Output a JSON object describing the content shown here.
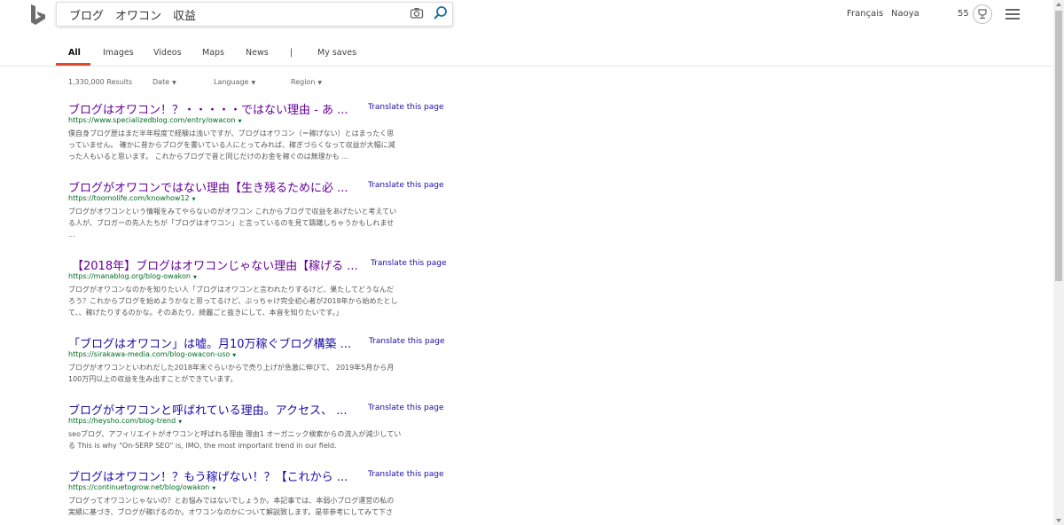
{
  "search": {
    "query": "ブログ　オワコン　収益"
  },
  "header": {
    "language": "Français",
    "user": "Naoya",
    "points": "55"
  },
  "tabs": [
    "All",
    "Images",
    "Videos",
    "Maps",
    "News",
    "|",
    "My saves"
  ],
  "filters": {
    "results_count": "1,330,000 Results",
    "date": "Date",
    "language": "Language",
    "region": "Region"
  },
  "results": [
    {
      "title": "ブログはオワコン！？・・・・・ではない理由 - あ ...",
      "translate": "Translate this page",
      "url": "https://www.specializedblog.com/entry/owacon",
      "snippet": [
        "僕自身ブログ歴はまだ半年程度で経験は浅いですが、ブログはオワコン（＝稼げない）とはまったく思",
        "っていません。 確かに昔からブログを書いている人にとってみれば、稼ぎづらくなって収益が大幅に減",
        "った人もいると思います。 これからブログで昔と同じだけのお金を稼ぐのは無理かも ..."
      ]
    },
    {
      "title": "ブログがオワコンではない理由【生き残るために必 ...",
      "translate": "Translate this page",
      "url": "https://toomolife.com/knowhow12",
      "snippet": [
        "ブログがオワコンという情報をみてやらないのがオワコン これからブログで収益をあげたいと考えてい",
        "る人が、ブロガーの先人たちが「ブログはオワコン」と言っているのを見て躊躇しちゃうかもしれませ",
        "..."
      ]
    },
    {
      "title": "【2018年】ブログはオワコンじゃない理由【稼げる ...",
      "translate": "Translate this page",
      "url": "https://manablog.org/blog-owakon",
      "snippet": [
        "ブログがオワコンなのかを知りたい人「ブログはオワコンと言われたりするけど、果たしてどうなんだ",
        "ろう？これからブログを始めようかなと思ってるけど、ぶっちゃけ完全初心者が2018年から始めたとし",
        "て、、稼げたりするのかな。そのあたり、綺麗ごと抜きにして、本音を知りたいです。」"
      ]
    },
    {
      "title": "「ブログはオワコン」は嘘。月10万稼ぐブログ構築 ...",
      "translate": "Translate this page",
      "url": "https://sirakawa-media.com/blog-owacon-uso",
      "snippet": [
        "ブログがオワコンといわれだした2018年末ぐらいからで売り上げが急激に伸びて、 2019年5月から月",
        "100万円以上の収益を生み出すことができています。"
      ]
    },
    {
      "title": "ブログがオワコンと呼ばれている理由。アクセス、 ...",
      "translate": "Translate this page",
      "url": "https://heysho.com/blog-trend",
      "snippet": [
        "seoブログ、アフィリエイトがオワコンと呼ばれる理由 理由1 オーガニック検索からの流入が減少してい",
        "る This is why \"On-SERP SEO\" is, IMO, the most important trend in our field."
      ]
    },
    {
      "title": "ブログはオワコン！？もう稼げない！？【これから ...",
      "translate": "Translate this page",
      "url": "https://continuetogrow.net/blog/owakon",
      "snippet": [
        "ブログってオワコンじゃないの？とお悩みではないでしょうか。本記事では、本弱小ブログ運営の私の",
        "実績に基づき、ブログが稼げるのか。オワコンなのかについて解説致します。是非参考にしてみて下さ"
      ]
    }
  ]
}
